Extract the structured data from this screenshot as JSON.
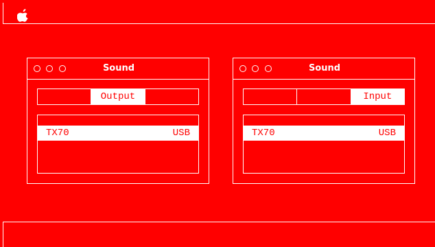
{
  "menubar": {
    "apple_icon": "apple-logo-icon"
  },
  "colors": {
    "background": "#ff0000",
    "foreground": "#ffffff"
  },
  "windows": [
    {
      "title": "Sound",
      "window_controls": [
        "circle-icon",
        "circle-icon",
        "circle-icon"
      ],
      "tabs": [
        {
          "label": "",
          "selected": false
        },
        {
          "label": "Output",
          "selected": true
        },
        {
          "label": "",
          "selected": false
        }
      ],
      "devices": [
        {
          "name": "TX70",
          "type": "USB",
          "selected": true
        }
      ]
    },
    {
      "title": "Sound",
      "window_controls": [
        "circle-icon",
        "circle-icon",
        "circle-icon"
      ],
      "tabs": [
        {
          "label": "",
          "selected": false
        },
        {
          "label": "",
          "selected": false
        },
        {
          "label": "Input",
          "selected": true
        }
      ],
      "devices": [
        {
          "name": "TX70",
          "type": "USB",
          "selected": true
        }
      ]
    }
  ]
}
